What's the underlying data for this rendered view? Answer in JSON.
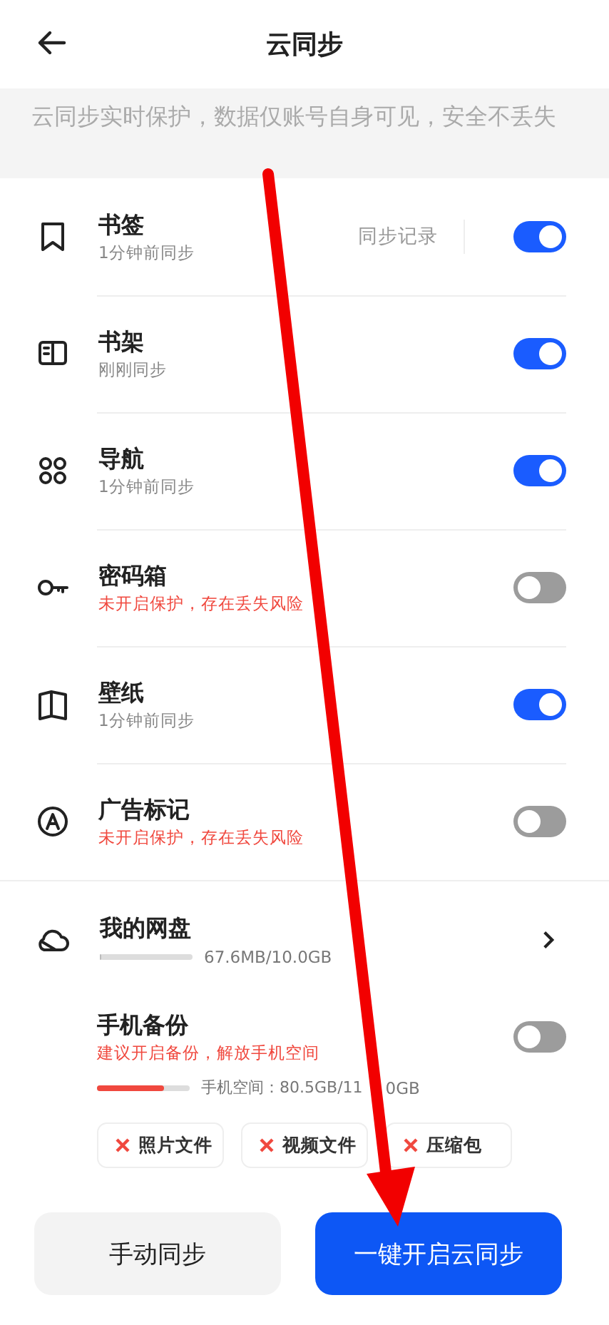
{
  "header": {
    "title": "云同步"
  },
  "notice": "云同步实时保护，数据仅账号自身可见，安全不丢失",
  "items": [
    {
      "title": "书签",
      "subtitle": "1分钟前同步",
      "alert": false,
      "action": "同步记录",
      "on": true
    },
    {
      "title": "书架",
      "subtitle": "刚刚同步",
      "alert": false,
      "on": true
    },
    {
      "title": "导航",
      "subtitle": "1分钟前同步",
      "alert": false,
      "on": true
    },
    {
      "title": "密码箱",
      "subtitle": "未开启保护，存在丢失风险",
      "alert": true,
      "on": false
    },
    {
      "title": "壁纸",
      "subtitle": "1分钟前同步",
      "alert": false,
      "on": true
    },
    {
      "title": "广告标记",
      "subtitle": "未开启保护，存在丢失风险",
      "alert": true,
      "on": false
    }
  ],
  "netdisk": {
    "title": "我的网盘",
    "level": 0.02,
    "usage": "67.6MB/10.0GB"
  },
  "backup": {
    "title": "手机备份",
    "subtitle": "建议开启备份，解放手机空间",
    "on": false,
    "level": 0.72,
    "space_left_part": "手机空间：80.5GB/11",
    "space_right_part": "0GB"
  },
  "file_types": [
    {
      "label": "照片文件"
    },
    {
      "label": "视频文件"
    },
    {
      "label": "压缩包"
    }
  ],
  "buttons": [
    {
      "label": "手动同步",
      "primary": false
    },
    {
      "label": "一键开启云同步",
      "primary": true
    }
  ]
}
